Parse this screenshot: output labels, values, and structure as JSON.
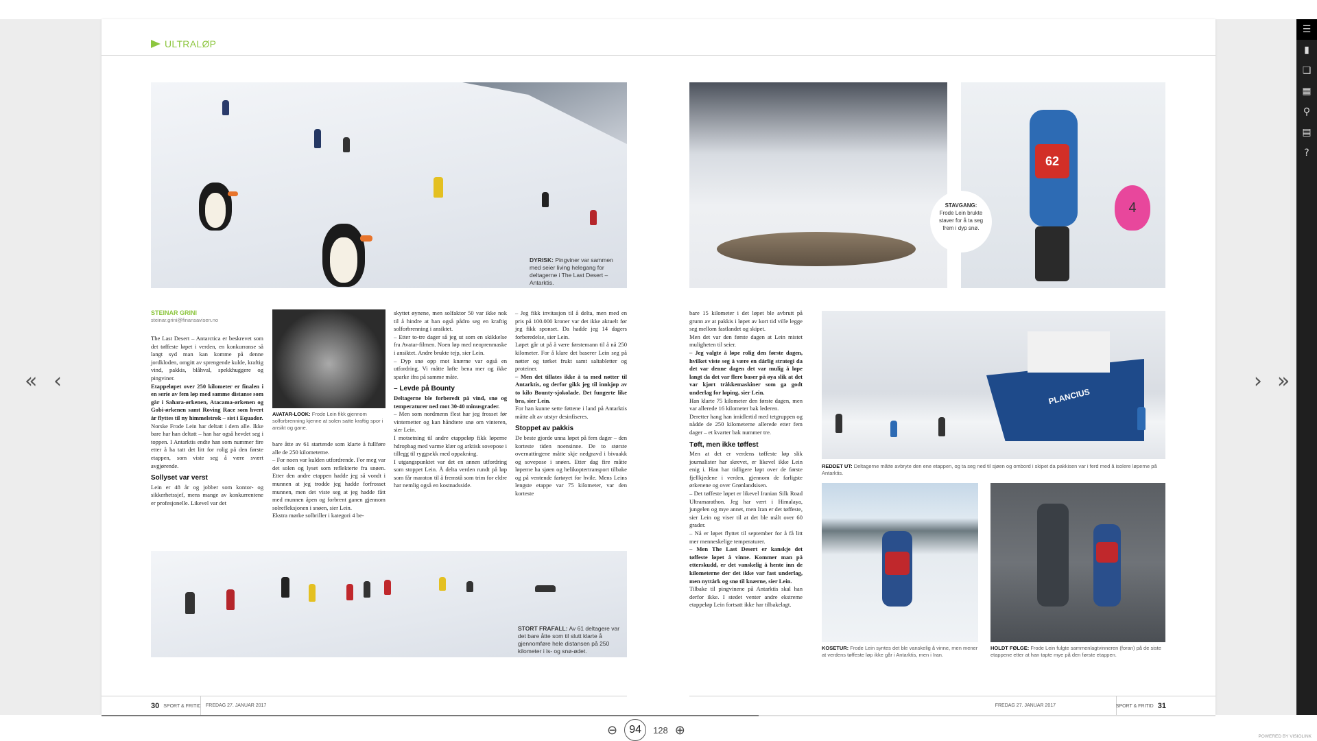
{
  "section": "ULTRALØP",
  "photos": {
    "top_left_caption": {
      "label": "DYRISK:",
      "text": "Pingviner var sammen med seier living helegang for deltagerne i The Last Desert – Antarktis."
    },
    "stavgang_caption": {
      "label": "STAVGANG:",
      "text": "Frode Lein brukte staver for å ta seg frem i dyp snø."
    },
    "bib_number": "62",
    "flag_number": "4"
  },
  "byline": {
    "name": "STEINAR GRINI",
    "email": "steinar.grini@finansavisen.no"
  },
  "portrait_caption": {
    "label": "AVATAR-LOOK:",
    "text": "Frode Lein fikk gjennom solforbrenning kjenne at solen satte kraftig spor i ansikt og gane."
  },
  "article": {
    "col1": {
      "p1": "The Last Desert – Antarctica er beskrevet som det tøffeste løpet i verden, en konkurranse så langt syd man kan komme på denne jordkloden, omgitt av sprengende kulde, kraftig vind, pakkis, blåhval, spekkhuggere og pingviner.",
      "p2": "Etappeløpet over 250 kilometer er finalen i en serie av fem løp med samme distanse som går i Sahara-ørkenen, Atacama-ørkenen og Gobi-ørkenen samt Roving Race som hvert år flyttes til ny himmelstrøk – sist i Equador.",
      "p3": "Norske Frode Lein har deltatt i dem alle. Ikke bare har han deltatt – han har også hevdet seg i toppen. I Antarktis endte han som nummer fire etter å ha tatt det litt for rolig på den første etappen, som viste seg å være svært avgjørende.",
      "h1": "Sollyset var verst",
      "p4": "Lein er 48 år og jobber som kontor- og sikkerhetssjef, mens mange av konkurrentene er profesjonelle. Likevel var det"
    },
    "col2": {
      "p1": "bare åtte av 61 startende som klarte å fullføre alle de 250 kilometerne.",
      "p2": "– For noen var kulden utfordrende. For meg var det solen og lyset som reflekterte fra snøen. Etter den andre etappen hadde jeg så vondt i munnen at jeg trodde jeg hadde forfrosset munnen, men det viste seg at jeg hadde fått med munnen åpen og forbrent ganen gjennom solrefleksjonen i snøen, sier Lein.",
      "p3": "Ekstra mørke solbriller i kategori 4 be-"
    },
    "col3": {
      "p1": "skyttet øynene, men solfaktor 50 var ikke nok til å hindre at han også pådro seg en kraftig solforbrenning i ansiktet.",
      "p2": "– Etter to-tre dager så jeg ut som en skikkelse fra Avatar-filmen. Noen løp med neoprenmaske i ansiktet. Andre brukte tejp, sier Lein.",
      "p3": "– Dyp snø opp mot knærne var også en utfordring. Vi måtte løfte bena mer og ikke sparke ifra på samme måte.",
      "h1": "– Levde på Bounty",
      "p4": "Deltagerne ble forberedt på vind, snø og temperaturer ned mot 30-40 minusgrader.",
      "p5": "– Men som nordmenn flest har jeg frosset før vinternetter og kan håndtere snø om vinteren, sier Lein.",
      "p6": "I motsetning til andre etappeløp fikk løperne hdropbag med varme klær og arktisk sovepose i tillegg til ryggsekk med oppakning.",
      "p7": "I utgangspunktet var det en annen utfordring som stoppet Lein. Å delta verden rundt på løp som får maraton til å fremstå som trim for eldre har nemlig også en kostnadsside."
    },
    "col4": {
      "p1": "– Jeg fikk invitasjon til å delta, men med en pris på 100.000 kroner var det ikke aktuelt før jeg fikk sponset. Da hadde jeg 14 dagers forberedelse, sier Lein.",
      "p2": "Løpet går ut på å være førstemann til å nå 250 kilometer. For å klare det baserer Lein seg på nøtter og tørket frukt samt saltabletter og proteiner.",
      "p3": "– Men det tillates ikke å ta med nøtter til Antarktis, og derfor gikk jeg til innkjøp av to kilo Bounty-sjokolade. Det fungerte like bra, sier Lein.",
      "p4": "For han kunne sette føttene i land på Antarktis måtte alt av utstyr desinfiseres.",
      "h1": "Stoppet av pakkis",
      "p5": "De beste gjorde unna løpet på fem dager – den korteste tiden noensinne. De to største overnattingene måtte skje nedgravd i bivuakk og sovepose i snøen. Etter dag fire måtte løperne ha sjøen og helikoptertransport tilbake og på ventende fartøyet for hvile. Mens Leins lengste etappe var 75 kilometer, var den korteste"
    },
    "col5": {
      "p1": "bare 15 kilometer i det løpet ble avbrutt på grunn av at pakkis i løpet av kort tid ville legge seg mellom fastlandet og skipet.",
      "p2": "Men det var den første dagen at Lein mistet muligheten til seier.",
      "p3": "– Jeg valgte å løpe rolig den første dagen, hvilket viste seg å være en dårlig strategi da det var denne dagen det var mulig å løpe langt da det var flere baser på øya slik at det var kjørt tråkkemaskiner som ga godt underlag for løping, sier Lein.",
      "p4": "Han klarte 75 kilometer den første dagen, men var allerede 16 kilometer bak lederen.",
      "p5": "Deretter hang han imidlertid med tetgruppen og nådde de 250 kilometerne allerede etter fem dager – et kvarter bak nummer tre.",
      "h1": "Tøft, men ikke tøffest",
      "p6": "Men at det er verdens tøffeste løp slik journalister har skrevet, er likevel ikke Lein enig i. Han har tidligere løpt over de første fjellkjedene i verden, gjennom de farligste ørkenene og over Grønlandsisen.",
      "p7": "– Det tøffeste løpet er likevel Iranian Silk Road Ultramarathon. Jeg har vært i Himalaya, jungelen og mye annet, men Iran er det tøffeste, sier Lein og viser til at det ble målt over 60 grader.",
      "p8": "– Nå er løpet flyttet til september for å få litt mer menneskelige temperaturer.",
      "p9": "– Men The Last Desert er kanskje det tøffeste løpet å vinne. Kommer man på etterskudd, er det vanskelig å hente inn de kilometerne der det ikke var fast underlag, men nyttårk og snø til knærne, sier Lein.",
      "p10": "Tilbake til pingvinene på Antarktis skal han derfor ikke. I stedet venter andre ekstreme etappeløp Lein fortsatt ikke har tilbakelagt."
    }
  },
  "ship_name": "PLANCIUS",
  "ship_caption": {
    "label": "REDDET UT:",
    "text": "Deltagerne måtte avbryte den ene etappen, og ta seg ned til sjøen og ombord i skipet da pakkisen var i ferd med å isolere løperne på Antarktis."
  },
  "bottom_strip_caption": {
    "label": "STORT FRAFALL:",
    "text": "Av 61 deltagere var det bare åtte som til slutt klarte å gjennomføre hele distansen på 250 kilometer i is- og snø-ødet."
  },
  "kosetur_caption": {
    "label": "KOSETUR:",
    "text": "Frode Lein syntes det ble vanskelig å vinne, men mener at verdens tøffeste løp ikke går i Antarktis, men i Iran."
  },
  "holdt_caption": {
    "label": "HOLDT FØLGE:",
    "text": "Frode Lein fulgte sammenlagtvinneren (foran) på de siste etappene etter at han tapte mye på den første etappen."
  },
  "footer_left": {
    "page": "30",
    "section": "SPORT & FRITID",
    "date": "FREDAG 27. JANUAR 2017"
  },
  "footer_right": {
    "page": "31",
    "section": "SPORT & FRITID",
    "date": "FREDAG 27. JANUAR 2017"
  },
  "nav": {
    "first": "«",
    "prev": "‹",
    "next": "›",
    "last": "»"
  },
  "pager": {
    "current": "94",
    "total": "128",
    "zoom_out": "⊖",
    "zoom_in": "⊕",
    "progress": 0.59
  },
  "sidebar": [
    "menu-icon",
    "page-icon",
    "pages-icon",
    "grid-icon",
    "search-icon",
    "list-icon",
    "help-icon"
  ],
  "powered": "POWERED BY VISIOLINK"
}
